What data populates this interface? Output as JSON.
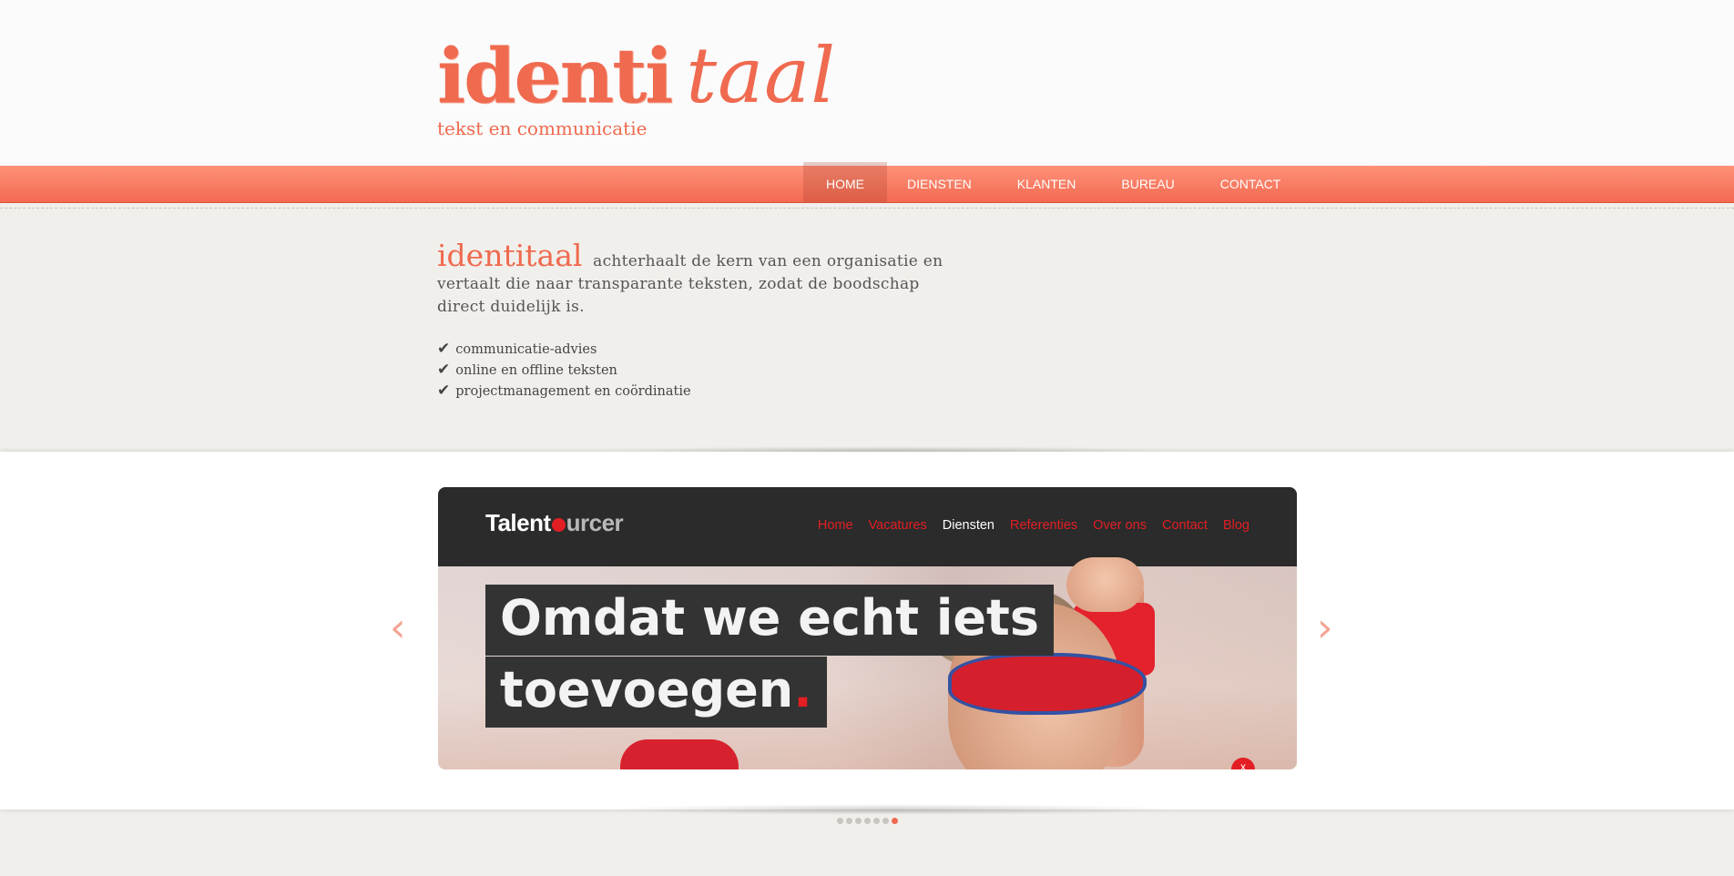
{
  "brand": {
    "logo_part1": "identi",
    "logo_part2": "taal",
    "tagline": "tekst en communicatie",
    "color": "#ef6a4f"
  },
  "nav": {
    "items": [
      {
        "label": "HOME",
        "active": true
      },
      {
        "label": "DIENSTEN",
        "active": false
      },
      {
        "label": "KLANTEN",
        "active": false
      },
      {
        "label": "BUREAU",
        "active": false
      },
      {
        "label": "CONTACT",
        "active": false
      }
    ]
  },
  "intro": {
    "brand_word": "identitaal",
    "text": "achterhaalt de kern van een organisatie en vertaalt die naar transparante teksten, zodat de boodschap direct duidelijk is.",
    "features": [
      "communicatie-advies",
      "online en offline teksten",
      "projectmanagement en coördinatie"
    ]
  },
  "slider": {
    "prev_icon": "chevron-left-icon",
    "next_icon": "chevron-right-icon",
    "prev_glyph": "‹",
    "next_glyph": "›",
    "slide": {
      "logo_talent": "Talent",
      "logo_rest": "urcer",
      "nav": [
        "Home",
        "Vacatures",
        "Diensten",
        "Referenties",
        "Over ons",
        "Contact",
        "Blog"
      ],
      "current_nav": "Diensten",
      "headline_line1": "Omdat we echt iets",
      "headline_line2": "toevoegen",
      "headline_dot": ".",
      "close_label": "x"
    },
    "dot_count": 7,
    "active_dot": 6
  }
}
